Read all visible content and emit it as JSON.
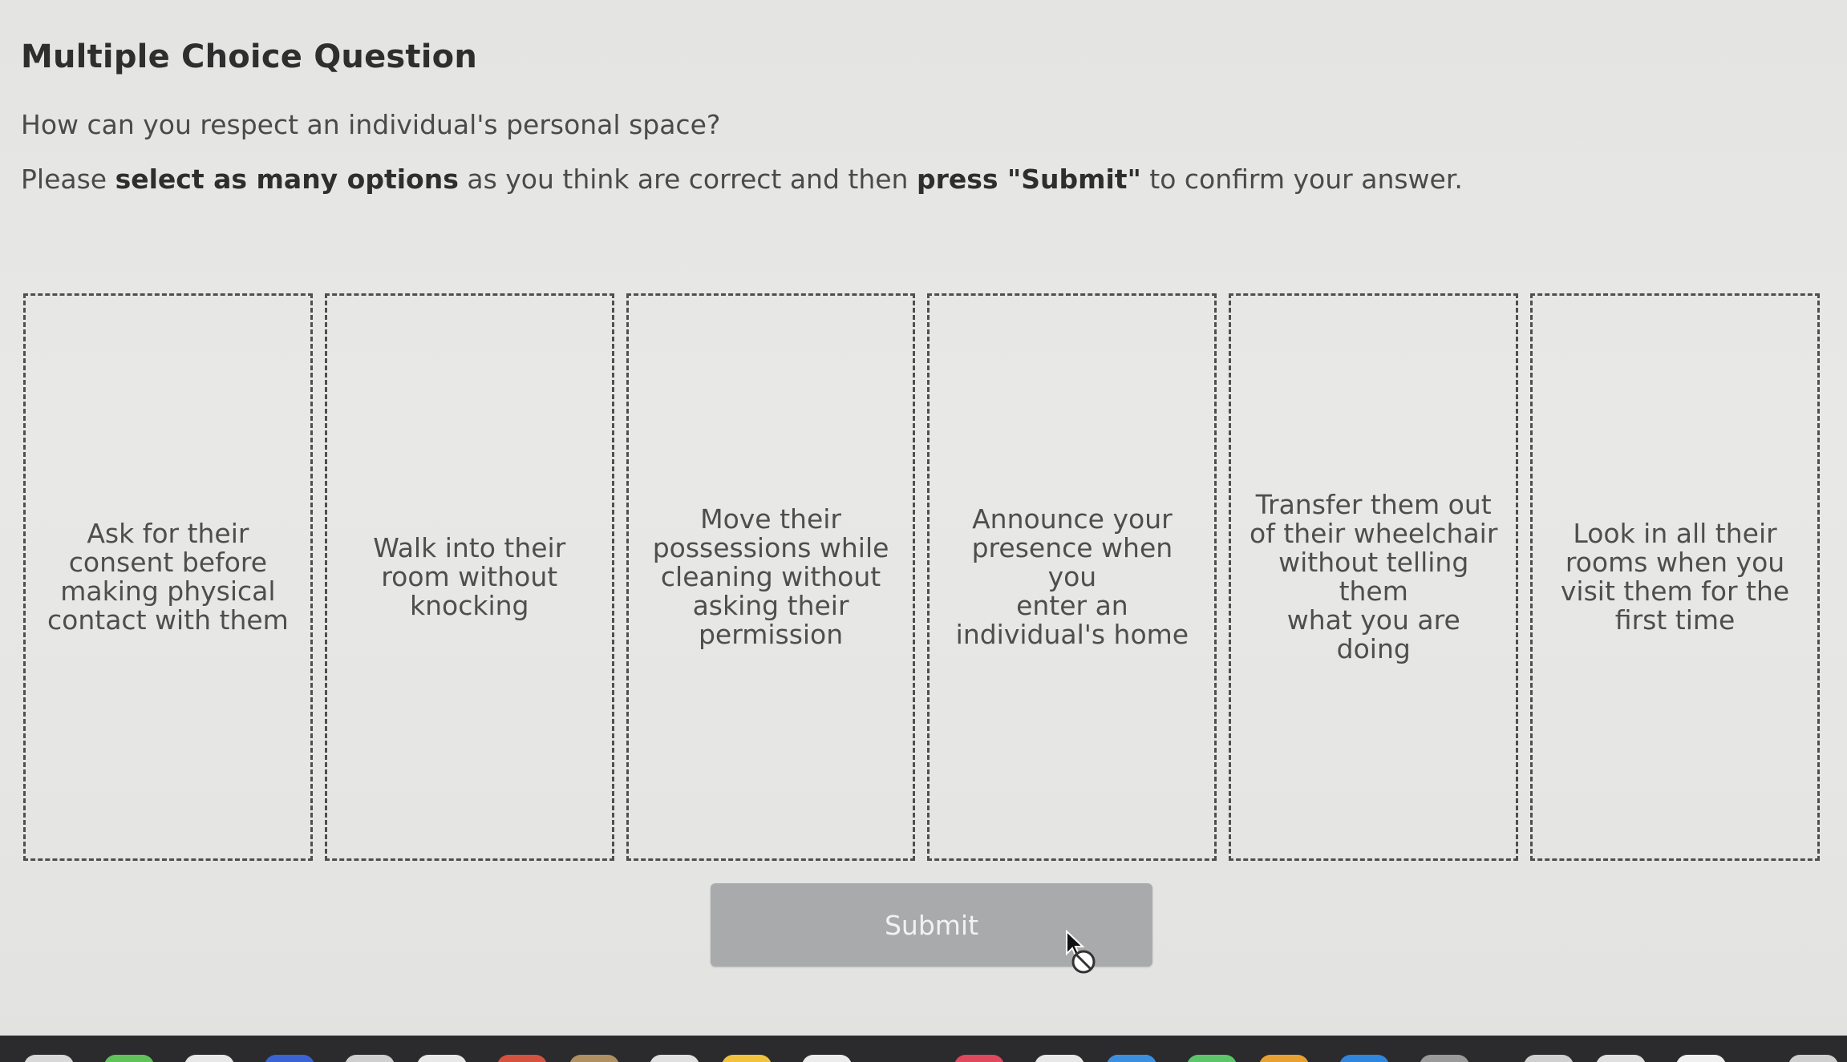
{
  "header": {
    "title": "Multiple Choice Question"
  },
  "question": {
    "text": "How can you respect an individual's personal space?"
  },
  "instructions": {
    "part1": "Please ",
    "bold1": "select as many options",
    "part2": " as you think are correct and then ",
    "bold2": "press \"Submit\"",
    "part3": " to confirm your answer."
  },
  "options": [
    {
      "label": "Ask for their\nconsent before\nmaking physical\ncontact with them"
    },
    {
      "label": "Walk into their\nroom without\nknocking"
    },
    {
      "label": "Move their\npossessions while\ncleaning without\nasking their\npermission"
    },
    {
      "label": "Announce your\npresence when you\nenter an\nindividual's home"
    },
    {
      "label": "Transfer them out\nof their wheelchair\nwithout telling them\nwhat you are doing"
    },
    {
      "label": "Look in all their\nrooms when you\nvisit them for the\nfirst time"
    }
  ],
  "submit": {
    "label": "Submit",
    "state": "disabled"
  },
  "cursor": {
    "icon": "not-allowed-cursor-icon"
  },
  "colors": {
    "submit_bg": "#a9aaab",
    "border": "#4f4f4f",
    "page_bg": "#e6e6e4",
    "dock_bg": "#2b2b2d"
  }
}
